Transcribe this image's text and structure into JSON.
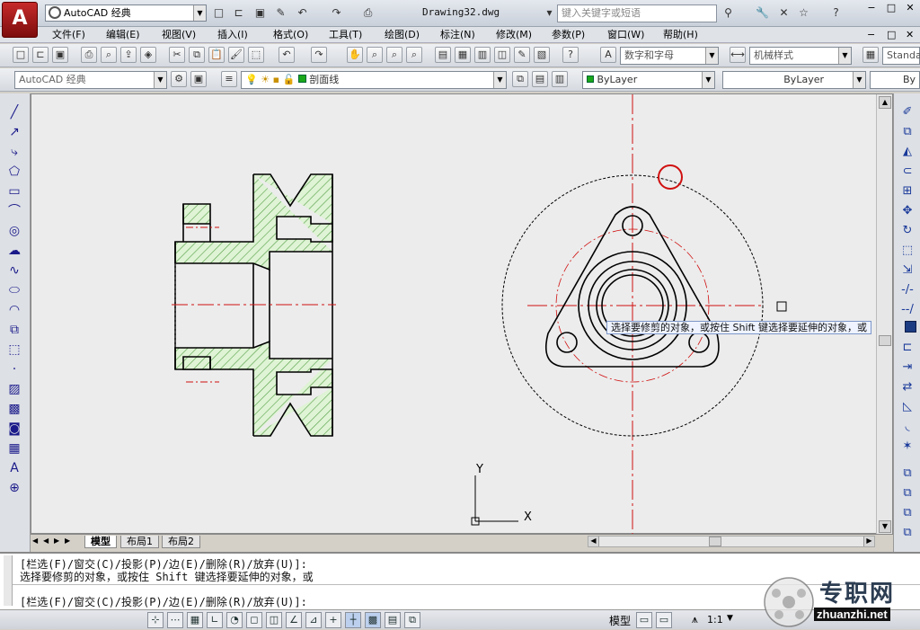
{
  "titlebar": {
    "workspace": "AutoCAD 经典",
    "document": "Drawing32.dwg",
    "search_placeholder": "键入关键字或短语",
    "app_logo": "A"
  },
  "menubar": {
    "items": [
      "文件(F)",
      "编辑(E)",
      "视图(V)",
      "插入(I)",
      "格式(O)",
      "工具(T)",
      "绘图(D)",
      "标注(N)",
      "修改(M)",
      "参数(P)",
      "窗口(W)",
      "帮助(H)"
    ]
  },
  "toolbar1": {
    "text_style": "数字和字母",
    "dim_style": "机械样式",
    "table_style": "Standa"
  },
  "toolbar2": {
    "workspace": "AutoCAD 经典",
    "layer": "剖面线",
    "color": "ByLayer",
    "linetype": "ByLayer",
    "lineweight": "By"
  },
  "tooltip": {
    "text": "选择要修剪的对象，或按住 Shift 键选择要延伸的对象，或"
  },
  "tabs": {
    "items": [
      "模型",
      "布局1",
      "布局2"
    ]
  },
  "ucs": {
    "x_label": "X",
    "y_label": "Y"
  },
  "command": {
    "line1": "[栏选(F)/窗交(C)/投影(P)/边(E)/删除(R)/放弃(U)]:",
    "line2": "选择要修剪的对象，或按住 Shift 键选择要延伸的对象，或",
    "line3": "[栏选(F)/窗交(C)/投影(P)/边(E)/删除(R)/放弃(U)]:"
  },
  "statusbar": {
    "model_label": "模型",
    "scale": "1:1"
  },
  "watermark": {
    "text": "专职网",
    "url": "zhuanzhi.net"
  },
  "colors": {
    "hatch": "#7fcf6e",
    "centerline": "#d01010",
    "highlight": "#d01010"
  }
}
